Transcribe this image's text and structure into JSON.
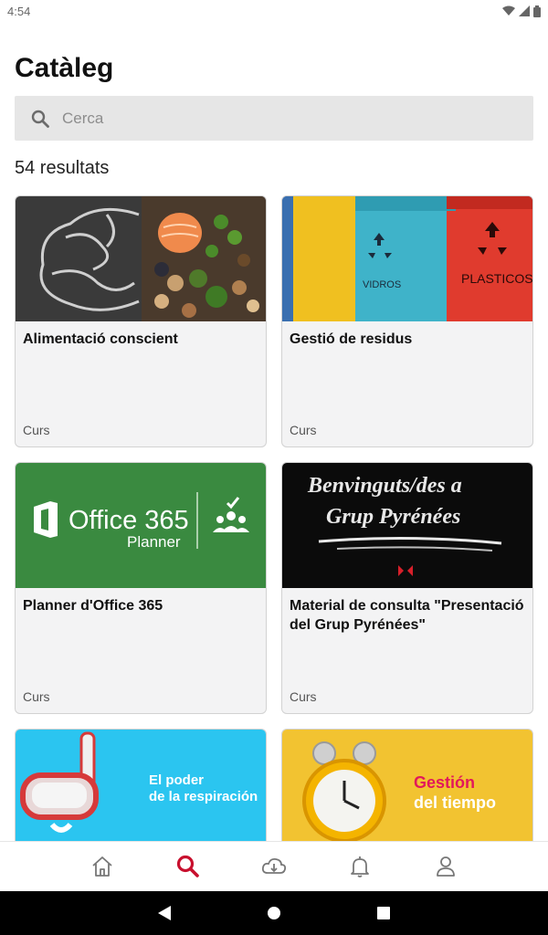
{
  "status": {
    "time": "4:54"
  },
  "page": {
    "title": "Catàleg"
  },
  "search": {
    "placeholder": "Cerca"
  },
  "results": {
    "count_label": "54 resultats"
  },
  "cards": [
    {
      "title": "Alimentació conscient",
      "type": "Curs",
      "image": "brain-food"
    },
    {
      "title": "Gestió de residus",
      "type": "Curs",
      "image": "recycling-bins",
      "bin_labels": [
        "VIDROS",
        "PLASTICOS"
      ]
    },
    {
      "title": "Planner d'Office 365",
      "type": "Curs",
      "image": "office365-planner",
      "img_text": {
        "brand": "Office 365",
        "sub": "Planner"
      },
      "color": "#3a8a40"
    },
    {
      "title": "Material de consulta \"Presentació del Grup Pyrénées\"",
      "type": "Curs",
      "image": "chalkboard",
      "img_text": {
        "line1": "Benvinguts/des a",
        "line2": "Grup Pyrénées"
      }
    },
    {
      "title": "",
      "type": "",
      "image": "snorkel",
      "img_text": {
        "line1": "El poder",
        "line2": "de la respiración"
      },
      "color": "#2bc5f0"
    },
    {
      "title": "",
      "type": "",
      "image": "alarm-clock",
      "img_text": {
        "line1": "Gestión",
        "line2": "del tiempo"
      },
      "color": "#f2c331"
    }
  ],
  "nav": [
    "home-icon",
    "search-icon",
    "download-cloud-icon",
    "bell-icon",
    "user-icon"
  ],
  "colors": {
    "accent": "#c8102e",
    "nav_inactive": "#777777"
  }
}
